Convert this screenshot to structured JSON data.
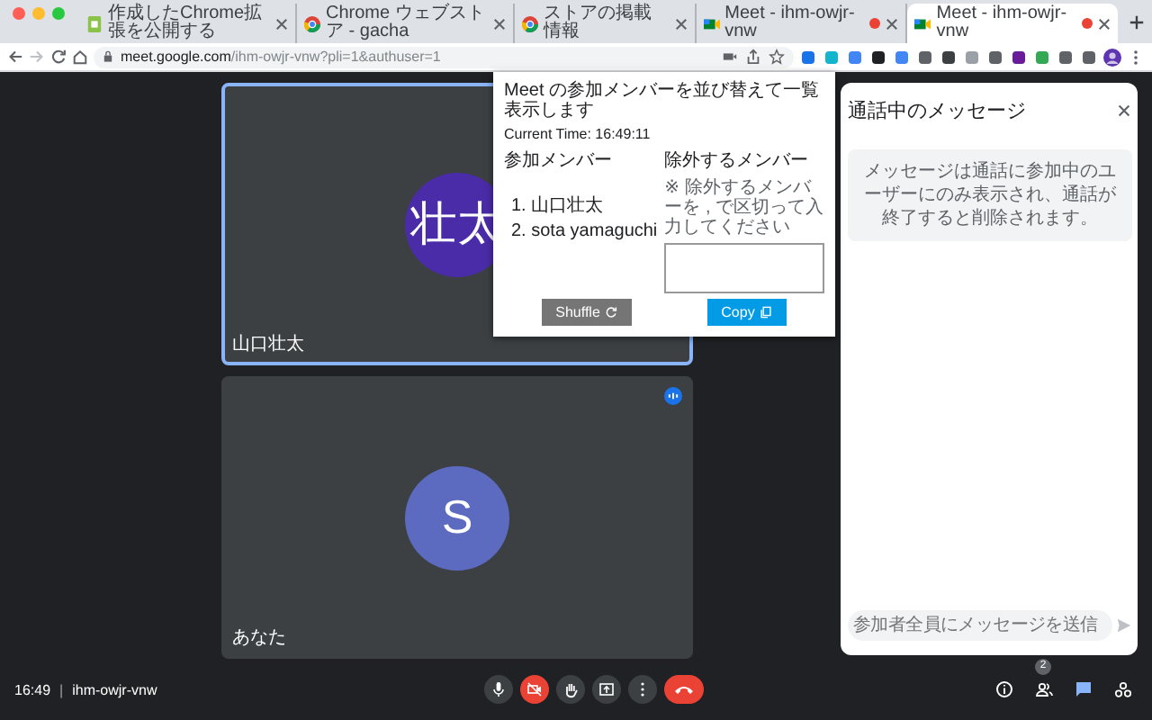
{
  "browser": {
    "tabs": [
      {
        "title": "作成したChrome拡張を公開する",
        "selected": false,
        "recording": false
      },
      {
        "title": "Chrome ウェブストア - gacha",
        "selected": false,
        "recording": false
      },
      {
        "title": "ストアの掲載情報",
        "selected": false,
        "recording": false
      },
      {
        "title": "Meet - ihm-owjr-vnw",
        "selected": false,
        "recording": true
      },
      {
        "title": "Meet - ihm-owjr-vnw",
        "selected": true,
        "recording": true
      }
    ],
    "address": {
      "host": "meet.google.com",
      "path": "/ihm-owjr-vnw?pli=1&authuser=1"
    }
  },
  "popup": {
    "heading": "Meet の参加メンバーを並び替えて一覧表示します",
    "current_time": "Current Time: 16:49:11",
    "members_label": "参加メンバー",
    "members": [
      "1. 山口壮太",
      "2. sota yamaguchi"
    ],
    "exclude_label": "除外するメンバー",
    "exclude_note": "※ 除外するメンバーを , で区切って入力してください",
    "buttons": [
      {
        "label": "Shuffle",
        "kind": "shuffle"
      },
      {
        "label": "Copy",
        "kind": "copy"
      }
    ]
  },
  "tiles": [
    {
      "initials": "壮太",
      "name": "山口壮太",
      "color": "#4a2ca8",
      "highlighted": true,
      "speaking": false
    },
    {
      "initials": "S",
      "name": "あなた",
      "color": "#5c6bc0",
      "highlighted": false,
      "speaking": true
    }
  ],
  "chat": {
    "title": "通話中のメッセージ",
    "notice": "メッセージは通話に参加中のユーザーにのみ表示され、通話が終了すると削除されます。",
    "placeholder": "参加者全員にメッセージを送信"
  },
  "bottom_bar": {
    "time": "16:49",
    "separator": "|",
    "meeting_code": "ihm-owjr-vnw",
    "controls": [
      {
        "kind": "mic",
        "off": false
      },
      {
        "kind": "camera",
        "off": true
      },
      {
        "kind": "hand",
        "off": false
      },
      {
        "kind": "present",
        "off": false
      },
      {
        "kind": "more",
        "off": false
      },
      {
        "kind": "hangup",
        "off": false
      }
    ],
    "side_controls": [
      {
        "kind": "info",
        "selected": false
      },
      {
        "kind": "people",
        "badge": "2",
        "selected": false
      },
      {
        "kind": "chat",
        "selected": true
      },
      {
        "kind": "activities",
        "selected": false
      }
    ]
  }
}
